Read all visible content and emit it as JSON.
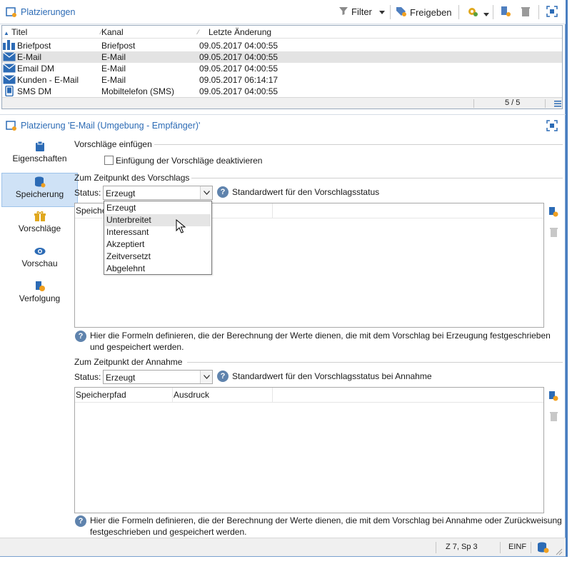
{
  "toolbar": {
    "title": "Platzierungen",
    "filter_label": "Filter",
    "release_label": "Freigeben"
  },
  "list": {
    "columns": [
      "Titel",
      "Kanal",
      "Letzte Änderung"
    ],
    "rows": [
      {
        "title": "Briefpost",
        "channel": "Briefpost",
        "modified": "09.05.2017 04:00:55",
        "icon": "mail-post-icon"
      },
      {
        "title": "E-Mail",
        "channel": "E-Mail",
        "modified": "09.05.2017 04:00:55",
        "icon": "envelope-icon"
      },
      {
        "title": "Email DM",
        "channel": "E-Mail",
        "modified": "09.05.2017 04:00:55",
        "icon": "envelope-icon"
      },
      {
        "title": "Kunden - E-Mail",
        "channel": "E-Mail",
        "modified": "09.05.2017 06:14:17",
        "icon": "envelope-icon"
      },
      {
        "title": "SMS DM",
        "channel": "Mobiltelefon (SMS)",
        "modified": "09.05.2017 04:00:55",
        "icon": "mobile-phone-icon"
      }
    ],
    "pagination": "5 / 5"
  },
  "detail": {
    "title": "Platzierung 'E-Mail (Umgebung - Empfänger)'"
  },
  "nav": {
    "items": [
      {
        "label": "Eigenschaften",
        "icon": "clipboard-icon"
      },
      {
        "label": "Speicherung",
        "icon": "database-icon"
      },
      {
        "label": "Vorschläge",
        "icon": "gift-icon"
      },
      {
        "label": "Vorschau",
        "icon": "eye-icon"
      },
      {
        "label": "Verfolgung",
        "icon": "tracking-icon"
      }
    ],
    "active": "Speicherung"
  },
  "form": {
    "insert_section": "Vorschläge einfügen",
    "disable_checkbox_label": "Einfügung der Vorschläge deaktivieren",
    "proposal_section": "Zum Zeitpunkt des Vorschlags",
    "status_label": "Status:",
    "proposal_status_value": "Erzeugt",
    "proposal_status_help": "Standardwert für den Vorschlagsstatus",
    "proposal_table_first_col": "Speicher",
    "proposal_note": "Hier die Formeln definieren, die der Berechnung der Werte dienen, die mit dem Vorschlag bei Erzeugung festgeschrieben und gespeichert werden.",
    "acceptance_section": "Zum Zeitpunkt der Annahme",
    "acceptance_status_value": "Erzeugt",
    "acceptance_status_help": "Standardwert für den Vorschlagsstatus bei Annahme",
    "acceptance_columns": [
      "Speicherpfad",
      "Ausdruck"
    ],
    "acceptance_note": "Hier die Formeln definieren, die der Berechnung der Werte dienen, die mit dem Vorschlag bei Annahme oder Zurückweisung festgeschrieben und gespeichert werden."
  },
  "dropdown": {
    "options": [
      "Erzeugt",
      "Unterbreitet",
      "Interessant",
      "Akzeptiert",
      "Zeitversetzt",
      "Abgelehnt"
    ],
    "hovered": "Unterbreitet"
  },
  "statusbar": {
    "position": "Z 7, Sp 3",
    "mode": "EINF"
  },
  "colors": {
    "accent": "#2c6bb5",
    "selected_nav": "#cfe2f6",
    "help": "#5f83ad"
  }
}
